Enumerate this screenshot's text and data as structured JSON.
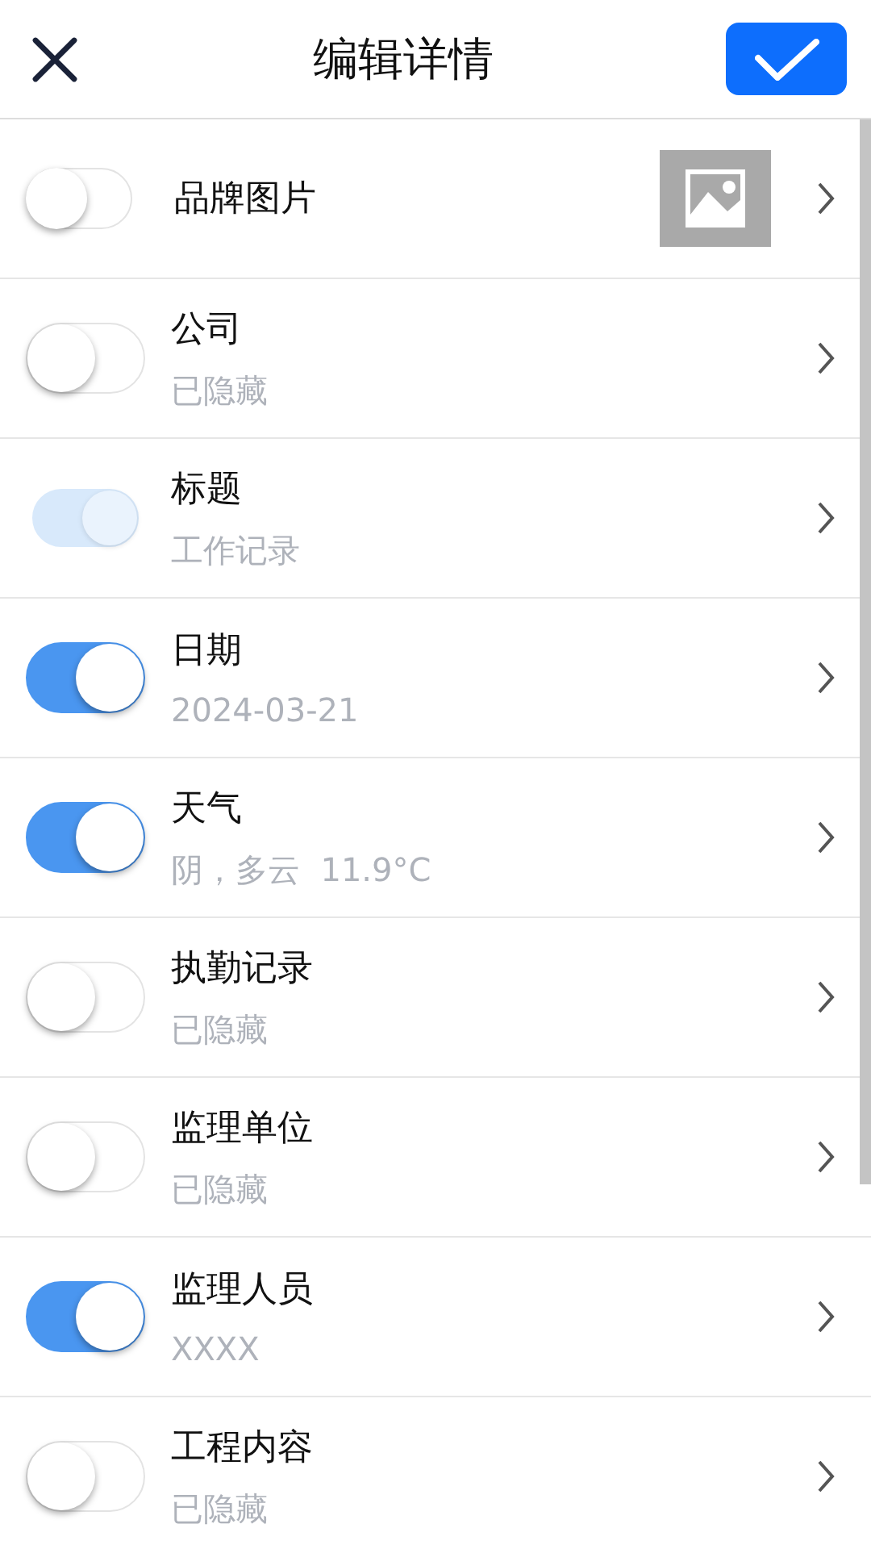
{
  "header": {
    "title": "编辑详情"
  },
  "rows": [
    {
      "kind": "image",
      "label": "品牌图片",
      "on": false,
      "disabled": false
    },
    {
      "kind": "text",
      "label": "公司",
      "value": "已隐藏",
      "on": false,
      "disabled": false
    },
    {
      "kind": "text",
      "label": "标题",
      "value": "工作记录",
      "on": true,
      "disabled": true
    },
    {
      "kind": "text",
      "label": "日期",
      "value": "2024-03-21",
      "on": true,
      "disabled": false
    },
    {
      "kind": "text",
      "label": "天气",
      "value": "阴，多云  11.9°C",
      "on": true,
      "disabled": false
    },
    {
      "kind": "text",
      "label": "执勤记录",
      "value": "已隐藏",
      "on": false,
      "disabled": false
    },
    {
      "kind": "text",
      "label": "监理单位",
      "value": "已隐藏",
      "on": false,
      "disabled": false
    },
    {
      "kind": "text",
      "label": "监理人员",
      "value": "XXXX",
      "on": true,
      "disabled": false
    },
    {
      "kind": "text",
      "label": "工程内容",
      "value": "已隐藏",
      "on": false,
      "disabled": false
    }
  ]
}
